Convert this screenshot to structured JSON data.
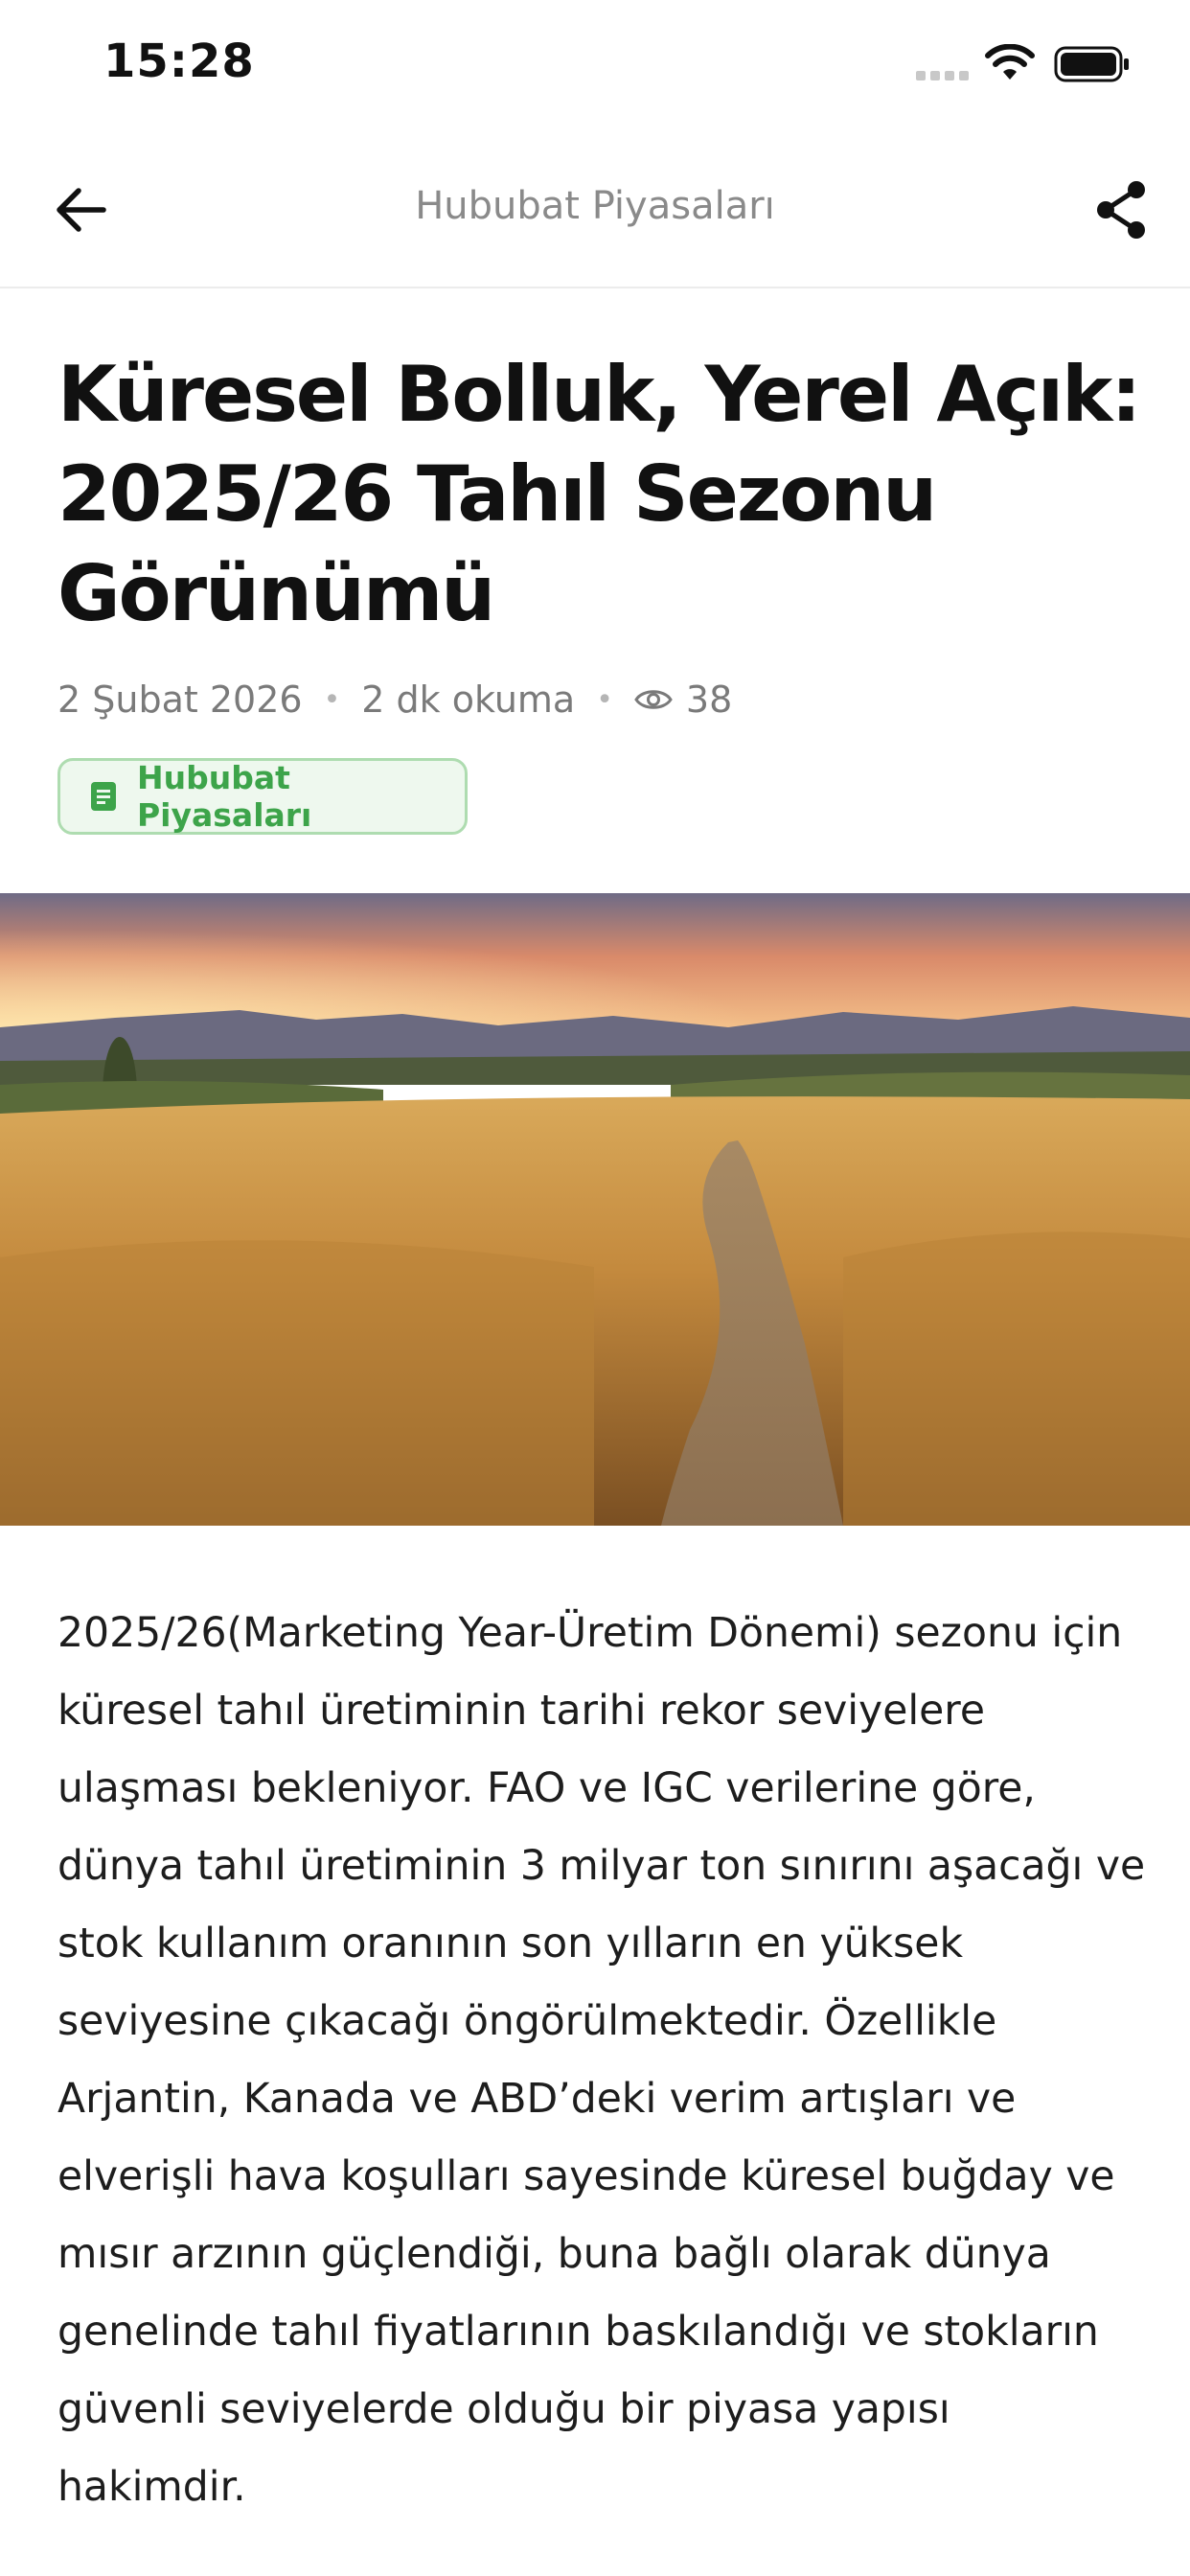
{
  "status_bar": {
    "time": "15:28"
  },
  "nav": {
    "title": "Hububat Piyasaları"
  },
  "article": {
    "title": "Küresel Bolluk, Yerel Açık: 2025/26 Tahıl Sezonu Görünümü",
    "date": "2 Şubat 2026",
    "read_time": "2 dk okuma",
    "views": "38",
    "category": "Hububat Piyasaları",
    "body": "2025/26(Marketing Year-Üretim Dönemi) sezonu için küresel tahıl üretiminin tarihi rekor seviyelere ulaşması bekleniyor. FAO ve IGC verilerine göre, dünya tahıl üretiminin 3 milyar ton sınırını aşacağı ve stok kullanım oranının son yılların en yüksek seviyesine çıkacağı öngörülmektedir. Özellikle Arjantin, Kanada ve ABD’deki verim artışları ve elverişli hava koşulları sayesinde küresel buğday ve mısır arzının güçlendiği, buna bağlı olarak dünya genelinde tahıl fiyatlarının baskılandığı ve stokların güvenli seviyelerde olduğu bir piyasa yapısı hakimdir."
  },
  "icons": {
    "back": "arrow-left-icon",
    "share": "share-icon",
    "views": "eye-icon",
    "category": "document-icon"
  },
  "colors": {
    "accent_green": "#3da44a",
    "badge_bg": "#eef8ee",
    "badge_border": "#aedcb0",
    "muted_text": "#7a7a7a"
  }
}
